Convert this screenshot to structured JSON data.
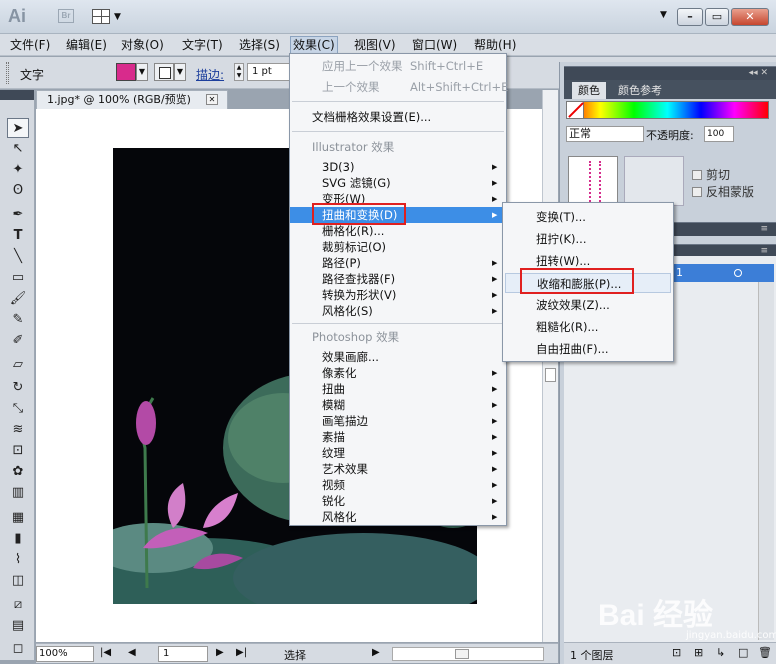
{
  "window": {
    "caret": "▼"
  },
  "menubar": {
    "items": [
      "文件(F)",
      "编辑(E)",
      "对象(O)",
      "文字(T)",
      "选择(S)",
      "效果(C)",
      "视图(V)",
      "窗口(W)",
      "帮助(H)"
    ],
    "active_index": 5
  },
  "control_bar": {
    "tool_label": "文字",
    "fill_color": "#d82b8c",
    "stroke_label": "描边:",
    "stroke_value": "1 pt"
  },
  "document": {
    "tab_title": "1.jpg* @ 100% (RGB/预览)",
    "close_glyph": "✕"
  },
  "status_bar": {
    "zoom": "100%",
    "page": "1",
    "tool": "选择"
  },
  "effect_menu": {
    "apply_last": "应用上一个效果",
    "apply_last_shortcut": "Shift+Ctrl+E",
    "last_effect": "上一个效果",
    "last_effect_shortcut": "Alt+Shift+Ctrl+E",
    "raster_settings": "文档栅格效果设置(E)...",
    "illustrator_header": "Illustrator 效果",
    "illustrator_items": [
      {
        "label": "3D(3)",
        "submenu": true
      },
      {
        "label": "SVG 滤镜(G)",
        "submenu": true
      },
      {
        "label": "变形(W)",
        "submenu": true
      },
      {
        "label": "扭曲和变换(D)",
        "submenu": true,
        "highlighted": true
      },
      {
        "label": "栅格化(R)...",
        "submenu": false
      },
      {
        "label": "裁剪标记(O)",
        "submenu": false
      },
      {
        "label": "路径(P)",
        "submenu": true
      },
      {
        "label": "路径查找器(F)",
        "submenu": true
      },
      {
        "label": "转换为形状(V)",
        "submenu": true
      },
      {
        "label": "风格化(S)",
        "submenu": true
      }
    ],
    "photoshop_header": "Photoshop 效果",
    "photoshop_items": [
      {
        "label": "效果画廊...",
        "submenu": false
      },
      {
        "label": "像素化",
        "submenu": true
      },
      {
        "label": "扭曲",
        "submenu": true
      },
      {
        "label": "模糊",
        "submenu": true
      },
      {
        "label": "画笔描边",
        "submenu": true
      },
      {
        "label": "素描",
        "submenu": true
      },
      {
        "label": "纹理",
        "submenu": true
      },
      {
        "label": "艺术效果",
        "submenu": true
      },
      {
        "label": "视频",
        "submenu": true
      },
      {
        "label": "锐化",
        "submenu": true
      },
      {
        "label": "风格化",
        "submenu": true
      }
    ],
    "submenu_arrow": "▶"
  },
  "distort_submenu": {
    "items": [
      "变换(T)...",
      "扭拧(K)...",
      "扭转(W)...",
      "收缩和膨胀(P)...",
      "波纹效果(Z)...",
      "粗糙化(R)...",
      "自由扭曲(F)..."
    ],
    "hover_index": 3
  },
  "right_panel": {
    "tabs": [
      "颜色",
      "颜色参考"
    ],
    "blend_mode": "正常",
    "opacity_label": "不透明度:",
    "opacity_value": "100",
    "clip_label": "剪切",
    "invert_mask_label": "反相蒙版",
    "layer_number": "1",
    "layers_count": "1 个图层"
  },
  "toolbar": {
    "icons": [
      "selection-icon",
      "direct-selection-icon",
      "magic-wand-icon",
      "lasso-icon",
      "pen-icon",
      "type-icon",
      "line-icon",
      "rectangle-icon",
      "paintbrush-icon",
      "pencil-icon",
      "eraser-icon",
      "rotate-icon",
      "scale-icon",
      "warp-icon",
      "free-transform-icon",
      "symbol-sprayer-icon",
      "graph-icon",
      "mesh-icon",
      "gradient-icon",
      "eyedropper-icon",
      "blend-icon",
      "slice-icon",
      "hand-icon",
      "zoom-icon"
    ]
  },
  "watermark": {
    "text": "Bai 经验",
    "sub": "jingyan.baidu.com"
  }
}
